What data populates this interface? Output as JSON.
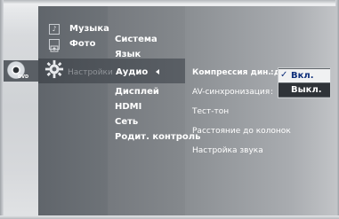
{
  "main_menu": {
    "music": "Музыка",
    "photo": "Фото",
    "settings": "Настройки"
  },
  "settings_menu": [
    "Система",
    "Язык",
    "Аудио",
    "Дисплей",
    "HDMI",
    "Сеть",
    "Родит. контроль"
  ],
  "audio_menu": [
    "Компрессия дин. диап",
    "AV-синхронизация",
    "Тест-тон",
    "Расстояние до колонок",
    "Настройка звука"
  ],
  "separators": [
    ":",
    ":"
  ],
  "popup": {
    "options": [
      "Вкл.",
      "Выкл."
    ]
  },
  "icons": {
    "disc": "disc-icon",
    "gear": "gear-icon",
    "music": "music-icon",
    "photo": "photo-icon"
  },
  "labels": {
    "disc": "DVD"
  }
}
